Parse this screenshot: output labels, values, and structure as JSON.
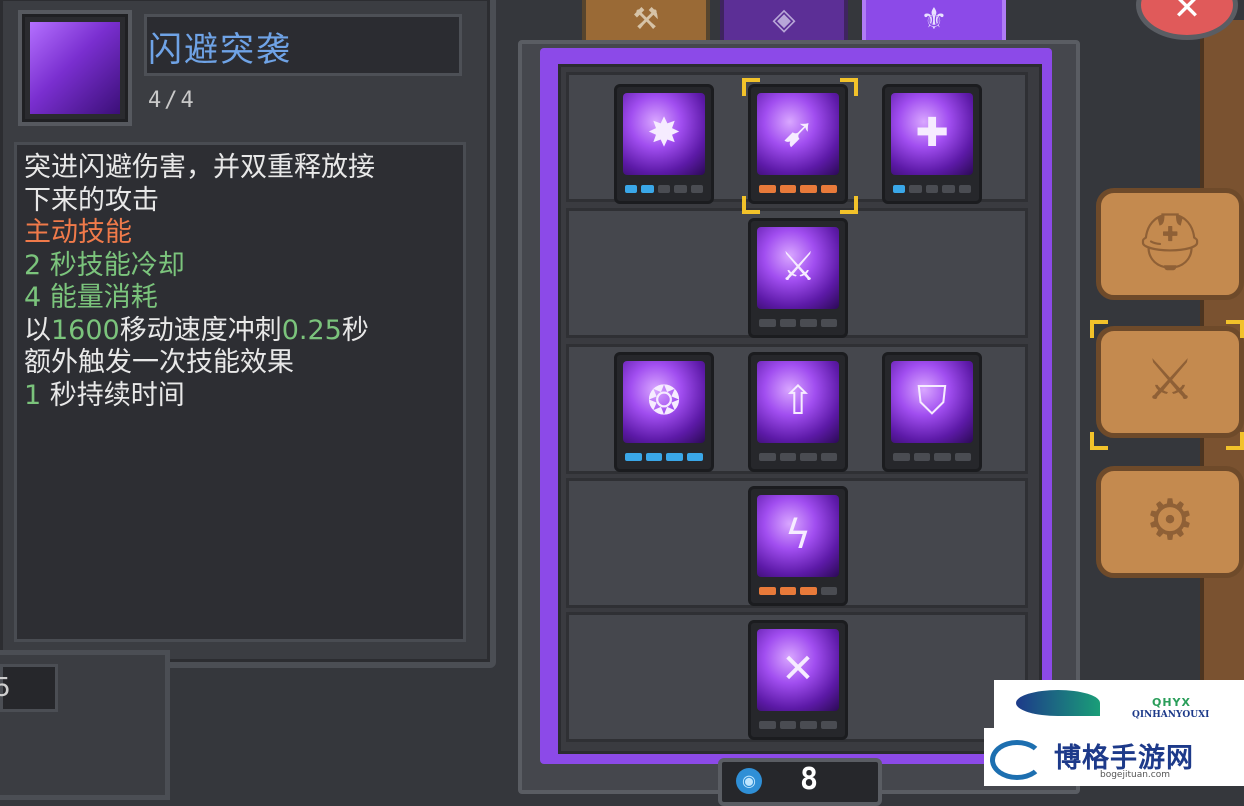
{
  "skill_detail": {
    "title": "闪避突袭",
    "level": "4/4",
    "description_lines": [
      {
        "segments": [
          {
            "text": "突进闪避伤害，并双重释放接",
            "color": "white"
          }
        ]
      },
      {
        "segments": [
          {
            "text": "下来的攻击",
            "color": "white"
          }
        ]
      },
      {
        "segments": [
          {
            "text": "主动技能",
            "color": "orange"
          }
        ]
      },
      {
        "segments": [
          {
            "text": "2 秒技能冷却",
            "color": "green"
          }
        ]
      },
      {
        "segments": [
          {
            "text": "4 能量消耗",
            "color": "green"
          }
        ]
      },
      {
        "segments": [
          {
            "text": "以",
            "color": "white"
          },
          {
            "text": "1600",
            "color": "green"
          },
          {
            "text": "移动速度冲刺",
            "color": "white"
          },
          {
            "text": "0.25",
            "color": "green"
          },
          {
            "text": "秒",
            "color": "white"
          }
        ]
      },
      {
        "segments": [
          {
            "text": "额外触发一次技能效果",
            "color": "white"
          }
        ]
      },
      {
        "segments": [
          {
            "text": "1",
            "color": "green"
          },
          {
            "text": " 秒持续时间",
            "color": "white"
          }
        ]
      }
    ],
    "stub_value": "5"
  },
  "tabs": [
    {
      "name": "tab-weapon",
      "icon": "weapon-icon",
      "glyph": "⚒",
      "active": false
    },
    {
      "name": "tab-diamond",
      "icon": "diamond-emblem-icon",
      "glyph": "◈",
      "active": false
    },
    {
      "name": "tab-crest",
      "icon": "crest-emblem-icon",
      "glyph": "⚜",
      "active": true
    }
  ],
  "skill_tree": {
    "rows": [
      {
        "nodes": [
          {
            "icon": "burst-icon",
            "glyph": "✸",
            "pips": [
              "blue",
              "blue",
              "gray",
              "gray",
              "gray"
            ],
            "selected": false
          },
          {
            "icon": "dash-strike-icon",
            "glyph": "➹",
            "pips": [
              "orange",
              "orange",
              "orange",
              "orange"
            ],
            "selected": true
          },
          {
            "icon": "heal-plus-icon",
            "glyph": "✚",
            "pips": [
              "blue",
              "gray",
              "gray",
              "gray",
              "gray"
            ],
            "selected": false
          }
        ]
      },
      {
        "nodes": [
          {
            "icon": "twin-swords-icon",
            "glyph": "⚔",
            "pips": [
              "gray",
              "gray",
              "gray",
              "gray"
            ],
            "selected": false
          }
        ]
      },
      {
        "nodes": [
          {
            "icon": "summon-pet-icon",
            "glyph": "❂",
            "pips": [
              "blue",
              "blue",
              "blue",
              "blue"
            ],
            "selected": false
          },
          {
            "icon": "sword-pillar-icon",
            "glyph": "⇧",
            "pips": [
              "gray",
              "gray",
              "gray",
              "gray"
            ],
            "selected": false
          },
          {
            "icon": "shield-up-icon",
            "glyph": "⛉",
            "pips": [
              "gray",
              "gray",
              "gray",
              "gray"
            ],
            "selected": false
          }
        ]
      },
      {
        "nodes": [
          {
            "icon": "lightning-dash-icon",
            "glyph": "ϟ",
            "pips": [
              "orange",
              "orange",
              "orange",
              "gray"
            ],
            "selected": false
          }
        ]
      },
      {
        "nodes": [
          {
            "icon": "sword-rain-icon",
            "glyph": "✕",
            "pips": [
              "gray",
              "gray",
              "gray",
              "gray"
            ],
            "selected": false
          }
        ]
      }
    ]
  },
  "side_buttons": [
    {
      "name": "character-button",
      "icon": "helmet-icon",
      "glyph": "⛑"
    },
    {
      "name": "skills-button",
      "icon": "sword-upgrade-icon",
      "glyph": "⚔"
    },
    {
      "name": "settings-button",
      "icon": "gear-icon",
      "glyph": "⚙"
    }
  ],
  "close_button": {
    "icon": "close-icon",
    "glyph": "✕"
  },
  "currency": {
    "icon": "blue-gem-icon",
    "glyph": "◉",
    "value": "8"
  },
  "watermark": {
    "latin_mark": "QHYX",
    "latin": "QINHANYOUXI",
    "chinese": "博格手游网",
    "domain": "bogejituan.com"
  },
  "colors": {
    "accent_purple": "#8c4ae8",
    "pip_blue": "#3aa7e8",
    "pip_orange": "#e87a3a",
    "selected_corner": "#f2c22a",
    "text_green": "#7bc47c",
    "text_orange": "#f07a4a",
    "title_blue": "#6fa3e6"
  }
}
